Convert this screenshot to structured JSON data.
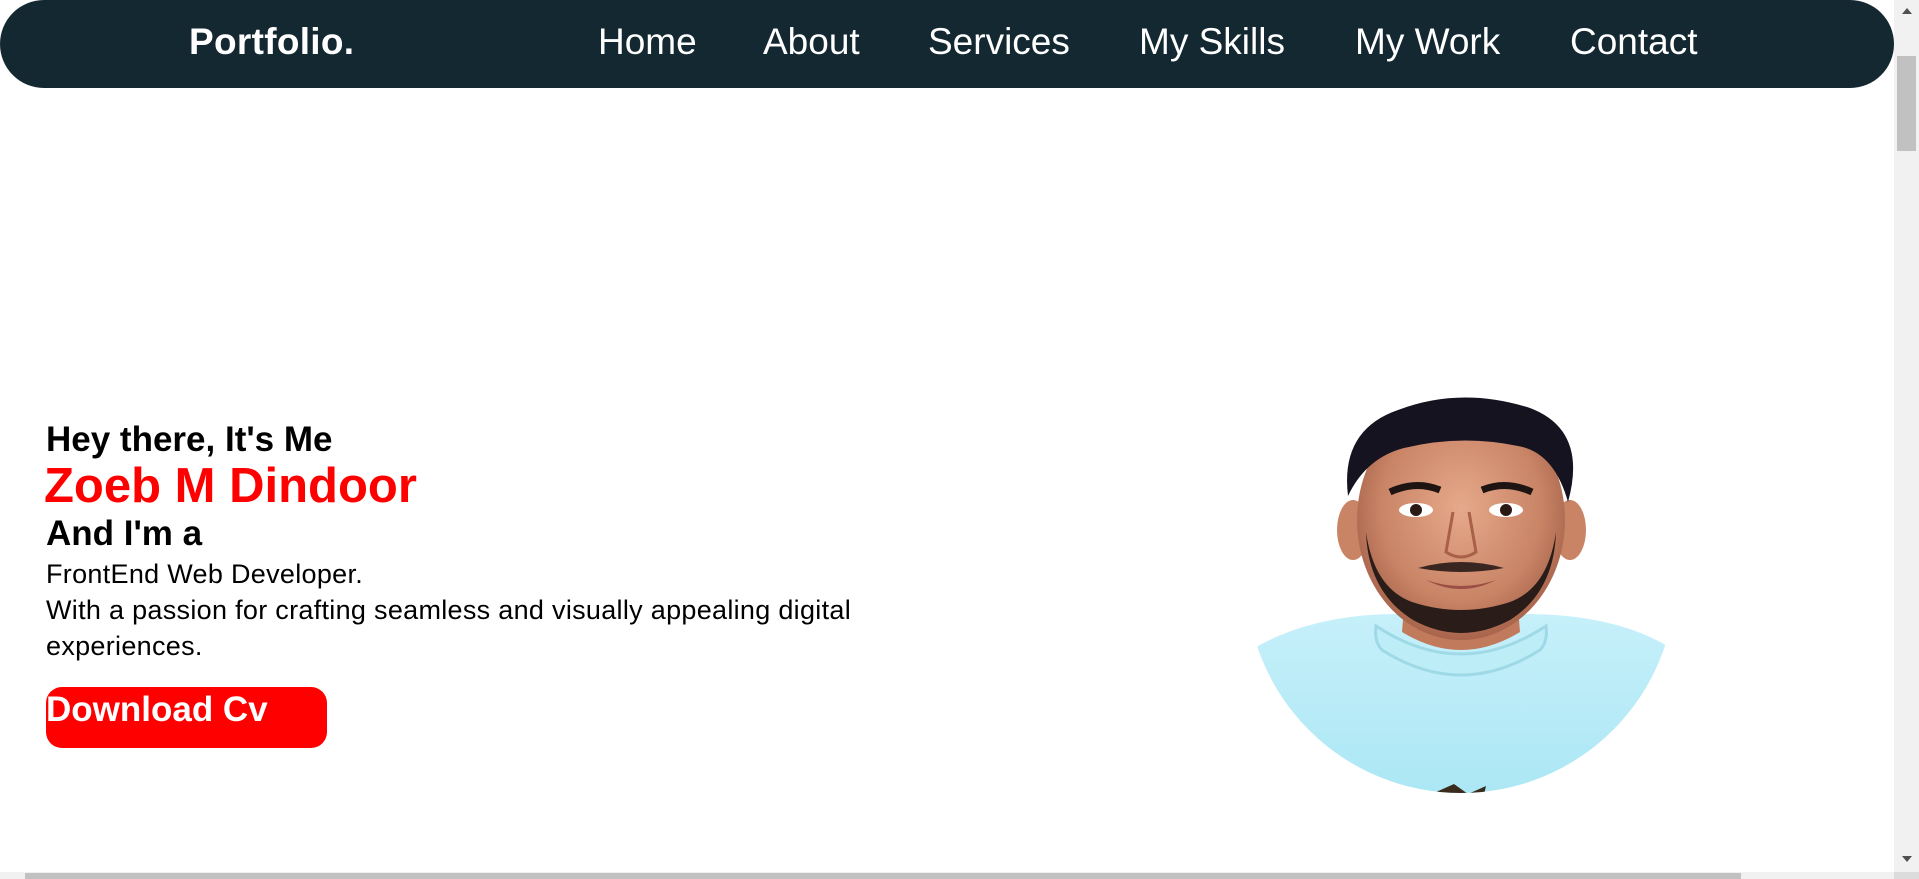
{
  "navbar": {
    "logo": "Portfolio.",
    "links": [
      "Home",
      "About",
      "Services",
      "My Skills",
      "My Work",
      "Contact"
    ]
  },
  "hero": {
    "greeting": "Hey there, It's Me",
    "name": "Zoeb M Dindoor",
    "role_intro": "And I'm a",
    "role": "FrontEnd Web Developer.",
    "description": "With a passion for crafting seamless and visually appealing digital experiences.",
    "cv_button": "Download Cv"
  },
  "colors": {
    "navbar_bg": "#132830",
    "accent": "#ff0000",
    "text": "#000000",
    "page_bg": "#ffffff"
  },
  "icons": [
    "profile-photo",
    "scroll-up-arrow-icon",
    "scroll-down-arrow-icon"
  ]
}
